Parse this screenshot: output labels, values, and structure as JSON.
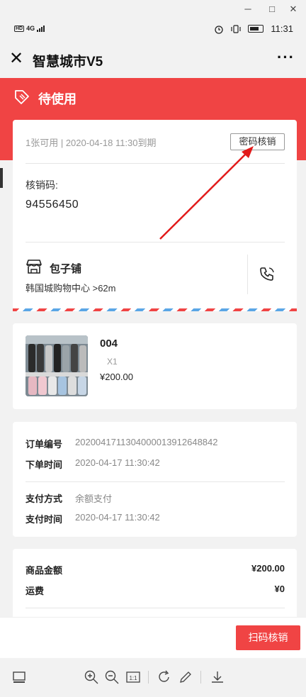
{
  "window": {
    "minimize": "─",
    "maximize": "□",
    "close": "✕"
  },
  "statusbar": {
    "hd": "HD",
    "net": "4G",
    "time": "11:31"
  },
  "nav": {
    "close_icon": "✕",
    "title": "智慧城市V5",
    "more": "···"
  },
  "header": {
    "status_title": "待使用",
    "icon": "ticket-icon"
  },
  "ticket": {
    "info": "1张可用 | 2020-04-18 11:30到期",
    "pwd_button": "密码核销",
    "code_label": "核销码:",
    "code": "94556450",
    "shop_name": "包子铺",
    "shop_address": "韩国城购物中心 >62m"
  },
  "product": {
    "name": "004",
    "qty": "X1",
    "price": "¥200.00"
  },
  "order": {
    "rows": [
      {
        "k": "订单编号",
        "v": "202004171130400001391264884​2"
      },
      {
        "k": "下单时间",
        "v": "2020-04-17 11:30:42"
      },
      {
        "k": "支付方式",
        "v": "余额支付"
      },
      {
        "k": "支付时间",
        "v": "2020-04-17 11:30:42"
      }
    ]
  },
  "amount": {
    "rows": [
      {
        "k": "商品金额",
        "v": "¥200.00"
      },
      {
        "k": "运费",
        "v": "¥0"
      }
    ]
  },
  "bottom": {
    "scan_button": "扫码核销"
  },
  "colors": {
    "accent": "#f04444",
    "airmail_blue": "#5aa6e6"
  }
}
